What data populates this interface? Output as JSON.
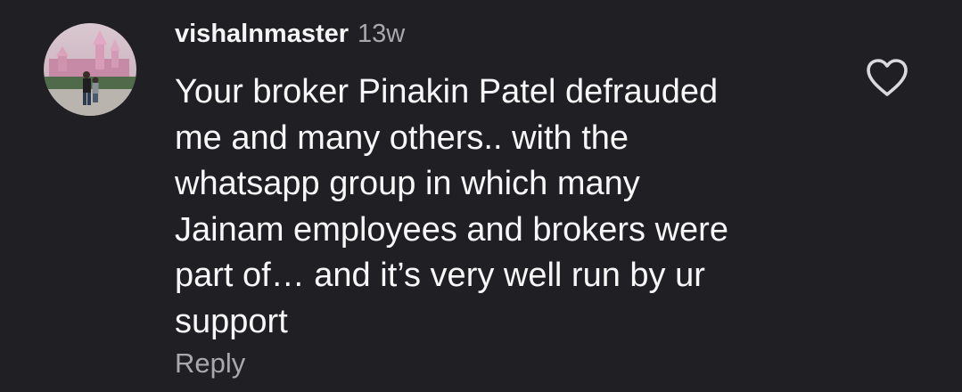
{
  "comment": {
    "avatar_icon": "user-photo-avatar",
    "username": "vishalnmaster",
    "timestamp": "13w",
    "text_lines": [
      "Your broker Pinakin Patel defrauded",
      "me and many others.. with the",
      "whatsapp group in which many",
      "Jainam employees and brokers were",
      "part of… and it’s very well run by ur",
      "support"
    ],
    "reply_label": "Reply",
    "like_icon": "heart-outline-icon"
  },
  "colors": {
    "background": "#1f1f24",
    "primary_text": "#f5f5f5",
    "secondary_text": "#a8a8ad",
    "icon_stroke": "#d9d9de"
  }
}
